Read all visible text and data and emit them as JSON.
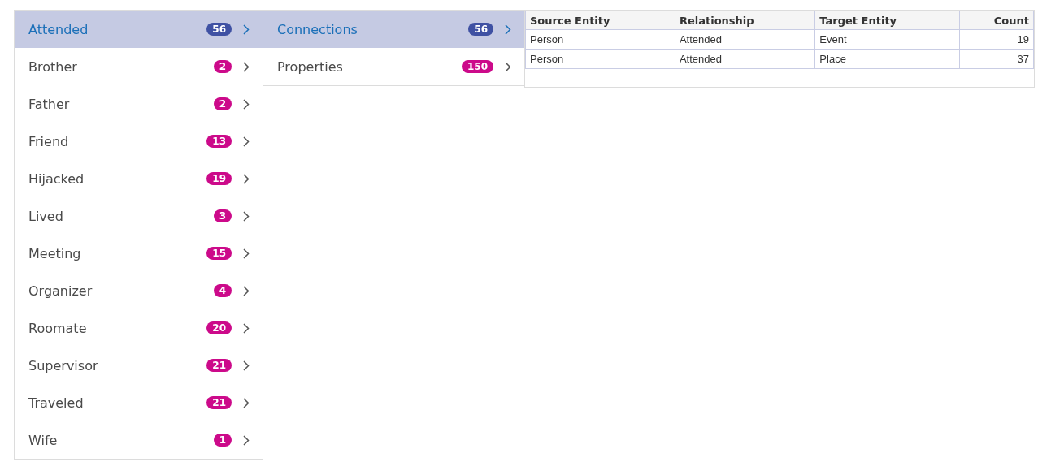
{
  "relationships": [
    {
      "label": "Attended",
      "count": "56",
      "selected": true
    },
    {
      "label": "Brother",
      "count": "2",
      "selected": false
    },
    {
      "label": "Father",
      "count": "2",
      "selected": false
    },
    {
      "label": "Friend",
      "count": "13",
      "selected": false
    },
    {
      "label": "Hijacked",
      "count": "19",
      "selected": false
    },
    {
      "label": "Lived",
      "count": "3",
      "selected": false
    },
    {
      "label": "Meeting",
      "count": "15",
      "selected": false
    },
    {
      "label": "Organizer",
      "count": "4",
      "selected": false
    },
    {
      "label": "Roomate",
      "count": "20",
      "selected": false
    },
    {
      "label": "Supervisor",
      "count": "21",
      "selected": false
    },
    {
      "label": "Traveled",
      "count": "21",
      "selected": false
    },
    {
      "label": "Wife",
      "count": "1",
      "selected": false
    }
  ],
  "details": [
    {
      "label": "Connections",
      "count": "56",
      "selected": true
    },
    {
      "label": "Properties",
      "count": "150",
      "selected": false
    }
  ],
  "table": {
    "columns": [
      "Source Entity",
      "Relationship",
      "Target Entity",
      "Count"
    ],
    "rows": [
      [
        "Person",
        "Attended",
        "Event",
        "19"
      ],
      [
        "Person",
        "Attended",
        "Place",
        "37"
      ]
    ]
  }
}
